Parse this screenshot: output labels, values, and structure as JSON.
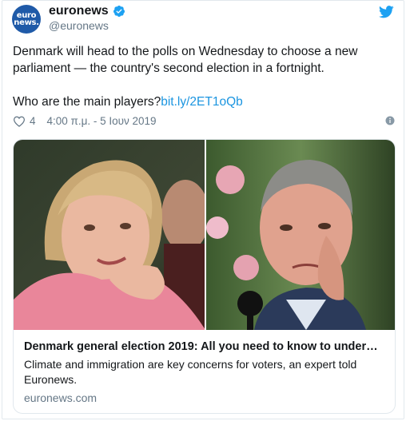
{
  "author": {
    "avatar_text_top": "euro",
    "avatar_text_bottom": "news.",
    "display_name": "euronews",
    "handle": "@euronews"
  },
  "tweet": {
    "text_line1": "Denmark will head to the polls on Wednesday to choose a new parliament — the country's second election in a fortnight.",
    "text_line2": "Who are the main players?",
    "link": "bit.ly/2ET1oQb",
    "likes": "4",
    "timestamp": "4:00 π.μ. - 5 Ιουν 2019"
  },
  "card": {
    "title": "Denmark general election 2019: All you need to know to under…",
    "description": "Climate and immigration are key concerns for voters, an expert told Euronews.",
    "domain": "euronews.com"
  },
  "colors": {
    "brand_blue": "#1da1f2",
    "link": "#1b95e0",
    "muted": "#657786",
    "avatar": "#1f5aa8"
  },
  "icons": {
    "verified": "verified-badge-icon",
    "twitter": "twitter-bird-icon",
    "like": "heart-icon",
    "info": "info-icon"
  }
}
